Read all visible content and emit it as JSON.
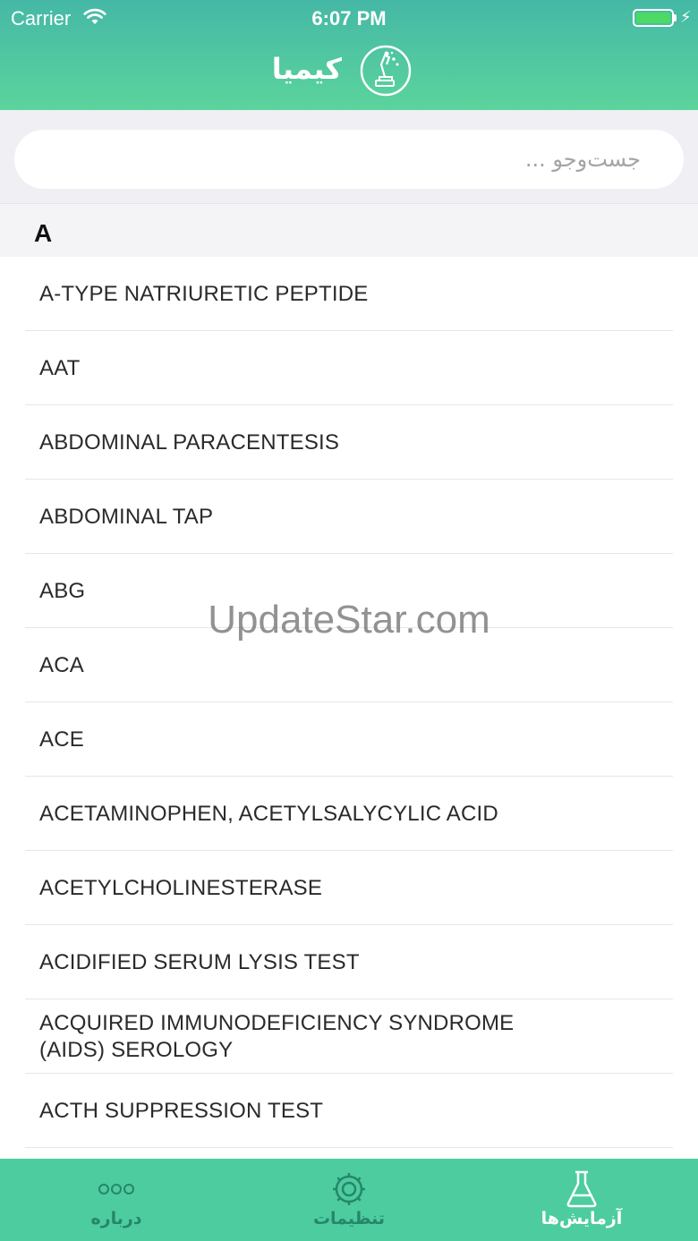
{
  "status_bar": {
    "carrier": "Carrier",
    "time": "6:07 PM",
    "battery_color": "#4cd964"
  },
  "header": {
    "title": "کیمیا",
    "logo_icon": "microscope-logo-icon"
  },
  "search": {
    "placeholder": "جست‌وجو ..."
  },
  "section": {
    "letter": "A"
  },
  "items": [
    "A-TYPE NATRIURETIC PEPTIDE",
    "AAT",
    "ABDOMINAL PARACENTESIS",
    "ABDOMINAL TAP",
    "ABG",
    "ACA",
    "ACE",
    "ACETAMINOPHEN, ACETYLSALYCYLIC ACID",
    "ACETYLCHOLINESTERASE",
    "ACIDIFIED SERUM LYSIS TEST",
    "ACQUIRED IMMUNODEFICIENCY SYNDROME (AIDS) SEROLOGY",
    "ACTH SUPPRESSION TEST",
    ""
  ],
  "watermark": "UpdateStar.com",
  "tabs": [
    {
      "label": "درباره",
      "icon": "more-dots-icon"
    },
    {
      "label": "تنظیمات",
      "icon": "gear-icon"
    },
    {
      "label": "آزمایش‌ها",
      "icon": "flask-icon"
    }
  ],
  "colors": {
    "header_top": "#45b8a6",
    "header_bottom": "#5bd49c",
    "tab_bar": "#4dcc9f",
    "tab_active": "#ffffff",
    "tab_inactive": "#26866a"
  }
}
